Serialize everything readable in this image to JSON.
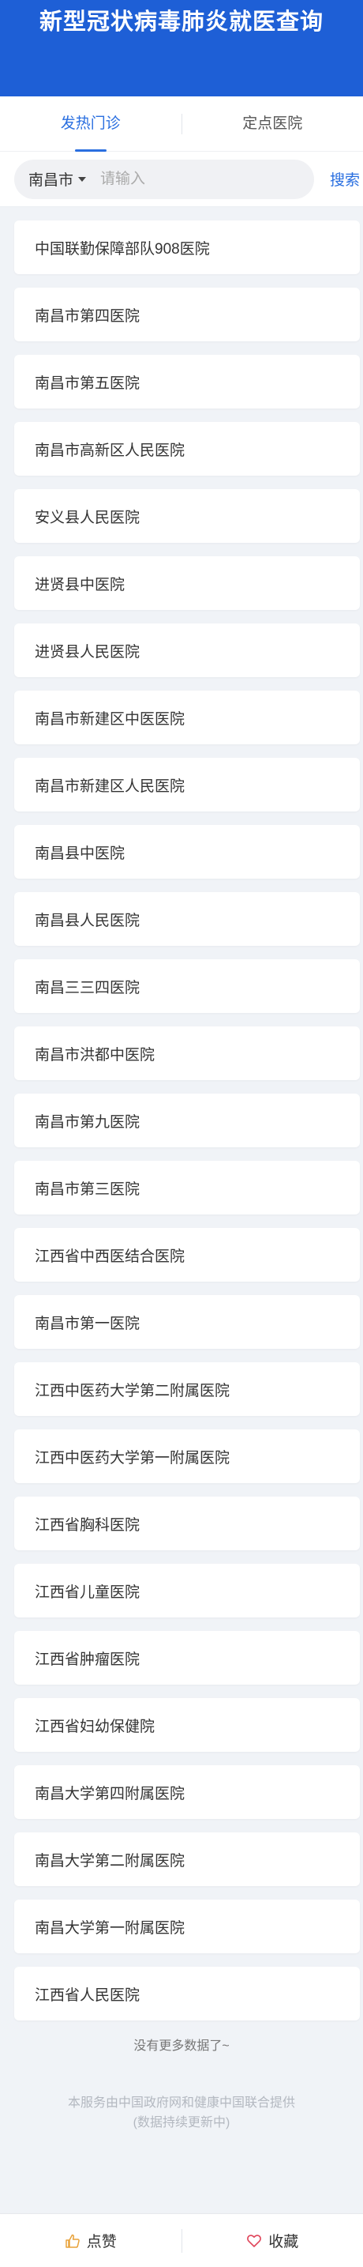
{
  "header": {
    "title": "新型冠状病毒肺炎就医查询"
  },
  "tabs": [
    {
      "label": "发热门诊",
      "active": true
    },
    {
      "label": "定点医院",
      "active": false
    }
  ],
  "search": {
    "city": "南昌市",
    "placeholder": "请输入",
    "value": "",
    "button": "搜索"
  },
  "hospitals": [
    "中国联勤保障部队908医院",
    "南昌市第四医院",
    "南昌市第五医院",
    "南昌市高新区人民医院",
    "安义县人民医院",
    "进贤县中医院",
    "进贤县人民医院",
    "南昌市新建区中医医院",
    "南昌市新建区人民医院",
    "南昌县中医院",
    "南昌县人民医院",
    "南昌三三四医院",
    "南昌市洪都中医院",
    "南昌市第九医院",
    "南昌市第三医院",
    "江西省中西医结合医院",
    "南昌市第一医院",
    "江西中医药大学第二附属医院",
    "江西中医药大学第一附属医院",
    "江西省胸科医院",
    "江西省儿童医院",
    "江西省肿瘤医院",
    "江西省妇幼保健院",
    "南昌大学第四附属医院",
    "南昌大学第二附属医院",
    "南昌大学第一附属医院",
    "江西省人民医院"
  ],
  "list_end": "没有更多数据了~",
  "footer": {
    "line1": "本服务由中国政府网和健康中国联合提供",
    "line2": "(数据持续更新中)"
  },
  "bottom": {
    "like": "点赞",
    "favorite": "收藏"
  },
  "colors": {
    "header_bg": "#1e5fd6",
    "accent": "#2a6fe0",
    "page_bg": "#f0f3f7"
  }
}
